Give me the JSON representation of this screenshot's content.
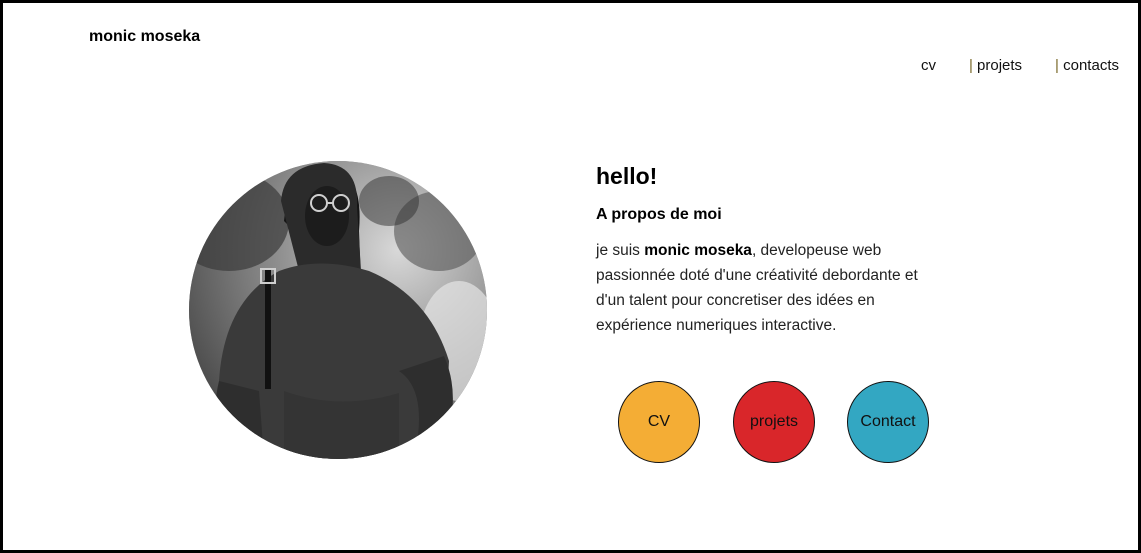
{
  "header": {
    "brand": "monic moseka",
    "nav": [
      {
        "label": "cv"
      },
      {
        "separator": "|",
        "label": "projets"
      },
      {
        "separator": "|",
        "label": "contacts"
      }
    ]
  },
  "profile": {
    "photo_alt": "monic moseka"
  },
  "about": {
    "greeting": "hello!",
    "title": "A propos de moi",
    "bio_prefix": "je suis ",
    "bio_name": "monic moseka",
    "bio_suffix": ", developeuse web passionnée doté d'une créativité debordante et d'un talent pour concretiser des idées en expérience numeriques interactive."
  },
  "buttons": [
    {
      "label": "CV",
      "color": "#f4ad35"
    },
    {
      "label": "projets",
      "color": "#d9262a"
    },
    {
      "label": "Contact",
      "color": "#33a7c2"
    }
  ],
  "colors": {
    "background": "#ffffff",
    "frame": "#000000"
  }
}
